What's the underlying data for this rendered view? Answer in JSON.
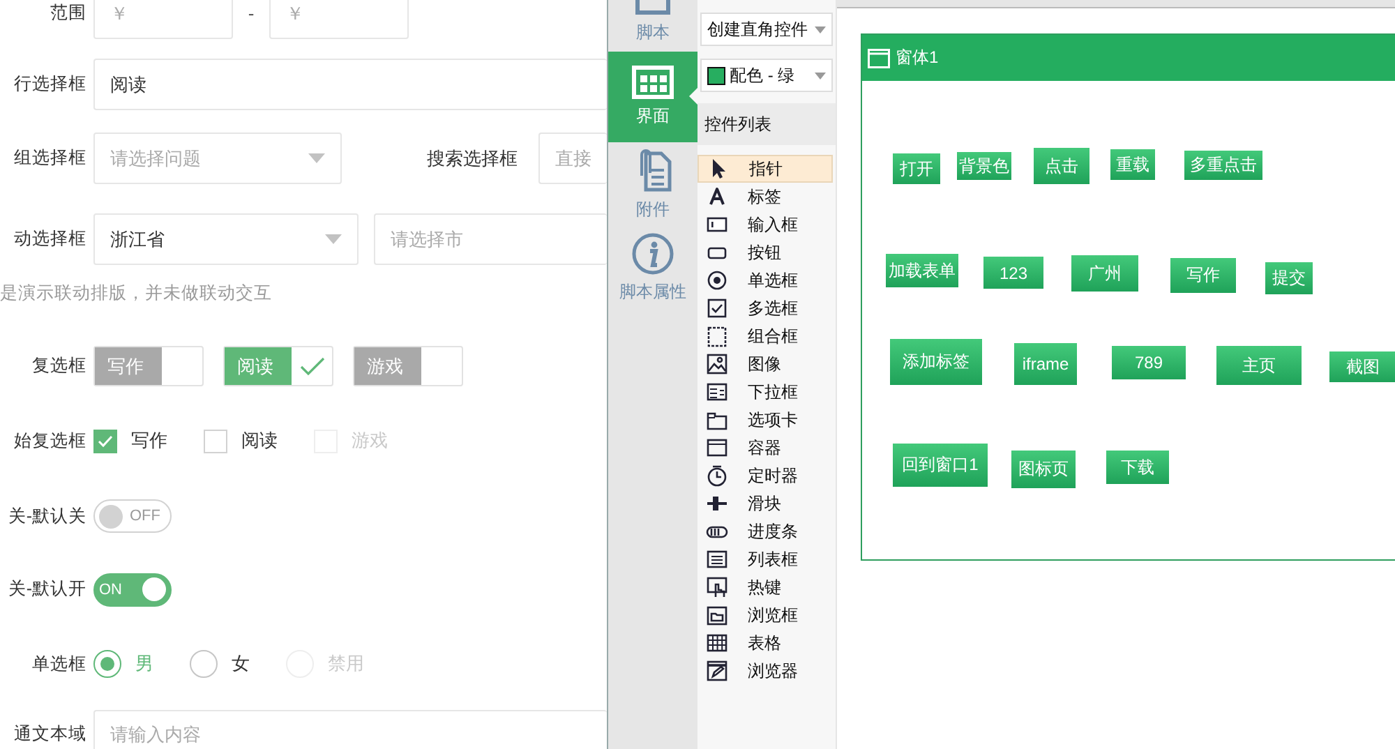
{
  "form": {
    "rows": [
      {
        "label": "范围",
        "controls": [
          {
            "kind": "input",
            "placeholder": "￥"
          },
          {
            "kind": "separator",
            "text": "-"
          },
          {
            "kind": "input",
            "placeholder": "￥"
          }
        ]
      },
      {
        "label": "行选择框",
        "controls": [
          {
            "kind": "input",
            "value": "阅读"
          }
        ]
      },
      {
        "label": "组选择框",
        "controls": [
          {
            "kind": "select",
            "placeholder": "请选择问题"
          },
          {
            "kind": "label",
            "text": "搜索选择框"
          },
          {
            "kind": "input",
            "placeholder": "直接"
          }
        ]
      },
      {
        "label": "动选择框",
        "controls": [
          {
            "kind": "select",
            "value": "浙江省"
          },
          {
            "kind": "input",
            "placeholder": "请选择市"
          }
        ]
      },
      {
        "kind": "note",
        "text": "是演示联动排版，并未做联动交互"
      },
      {
        "label": "复选框",
        "controls": [
          {
            "kind": "tag_check",
            "text": "写作",
            "checked": false
          },
          {
            "kind": "tag_check",
            "text": "阅读",
            "checked": true
          },
          {
            "kind": "tag_check",
            "text": "游戏",
            "checked": false
          }
        ]
      },
      {
        "label": "始复选框",
        "controls": [
          {
            "kind": "check",
            "text": "写作",
            "checked": true,
            "disabled": false
          },
          {
            "kind": "check",
            "text": "阅读",
            "checked": false,
            "disabled": false
          },
          {
            "kind": "check",
            "text": "游戏",
            "checked": false,
            "disabled": true
          }
        ]
      },
      {
        "label": "关-默认关",
        "controls": [
          {
            "kind": "switch",
            "text": "OFF",
            "on": false
          }
        ]
      },
      {
        "label": "关-默认开",
        "controls": [
          {
            "kind": "switch",
            "text": "ON",
            "on": true
          }
        ]
      },
      {
        "label": "单选框",
        "controls": [
          {
            "kind": "radio",
            "text": "男",
            "selected": true,
            "disabled": false
          },
          {
            "kind": "radio",
            "text": "女",
            "selected": false,
            "disabled": false
          },
          {
            "kind": "radio",
            "text": "禁用",
            "selected": false,
            "disabled": true
          }
        ]
      },
      {
        "label": "通文本域",
        "controls": [
          {
            "kind": "textarea",
            "placeholder": "请输入内容"
          }
        ]
      }
    ]
  },
  "nav": {
    "items": [
      {
        "label": "脚本",
        "selected": false
      },
      {
        "label": "界面",
        "selected": true
      },
      {
        "label": "附件",
        "selected": false
      },
      {
        "label": "脚本属性",
        "selected": false
      }
    ]
  },
  "toolbox": {
    "create_mode": "创建直角控件",
    "color_scheme": "配色 - 绿",
    "list_title": "控件列表",
    "items": [
      {
        "label": "指针",
        "selected": true
      },
      {
        "label": "标签",
        "selected": false
      },
      {
        "label": "输入框",
        "selected": false
      },
      {
        "label": "按钮",
        "selected": false
      },
      {
        "label": "单选框",
        "selected": false
      },
      {
        "label": "多选框",
        "selected": false
      },
      {
        "label": "组合框",
        "selected": false
      },
      {
        "label": "图像",
        "selected": false
      },
      {
        "label": "下拉框",
        "selected": false
      },
      {
        "label": "选项卡",
        "selected": false
      },
      {
        "label": "容器",
        "selected": false
      },
      {
        "label": "定时器",
        "selected": false
      },
      {
        "label": "滑块",
        "selected": false
      },
      {
        "label": "进度条",
        "selected": false
      },
      {
        "label": "列表框",
        "selected": false
      },
      {
        "label": "热键",
        "selected": false
      },
      {
        "label": "浏览框",
        "selected": false
      },
      {
        "label": "表格",
        "selected": false
      },
      {
        "label": "浏览器",
        "selected": false
      }
    ]
  },
  "designer": {
    "window_title": "窗体1",
    "buttons": [
      {
        "label": "打开"
      },
      {
        "label": "背景色"
      },
      {
        "label": "点击"
      },
      {
        "label": "重载"
      },
      {
        "label": "多重点击"
      },
      {
        "label": "加载表单"
      },
      {
        "label": "123"
      },
      {
        "label": "广州"
      },
      {
        "label": "写作"
      },
      {
        "label": "提交"
      },
      {
        "label": "添加标签"
      },
      {
        "label": "iframe"
      },
      {
        "label": "789"
      },
      {
        "label": "主页"
      },
      {
        "label": "截图"
      },
      {
        "label": "回到窗口1"
      },
      {
        "label": "图标页"
      },
      {
        "label": "下载"
      }
    ]
  }
}
